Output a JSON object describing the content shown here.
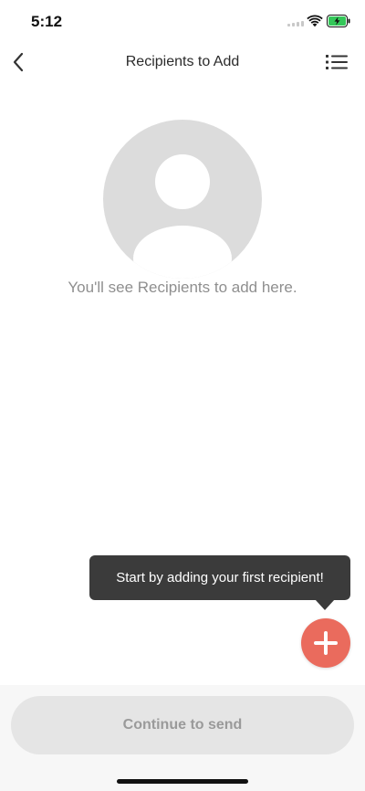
{
  "status_bar": {
    "time": "5:12",
    "icons": [
      "signal-icon",
      "wifi-icon",
      "battery-charging-icon"
    ],
    "battery_color": "#34c759"
  },
  "nav": {
    "title": "Recipients to Add",
    "back_icon": "chevron-left-icon",
    "menu_icon": "list-icon"
  },
  "empty_state": {
    "icon": "person-placeholder-icon",
    "message": "You'll see Recipients to add here."
  },
  "tooltip": {
    "text": "Start by adding your first recipient!"
  },
  "fab": {
    "icon": "plus-icon",
    "color": "#ea6b5d"
  },
  "footer": {
    "continue_label": "Continue to send"
  }
}
